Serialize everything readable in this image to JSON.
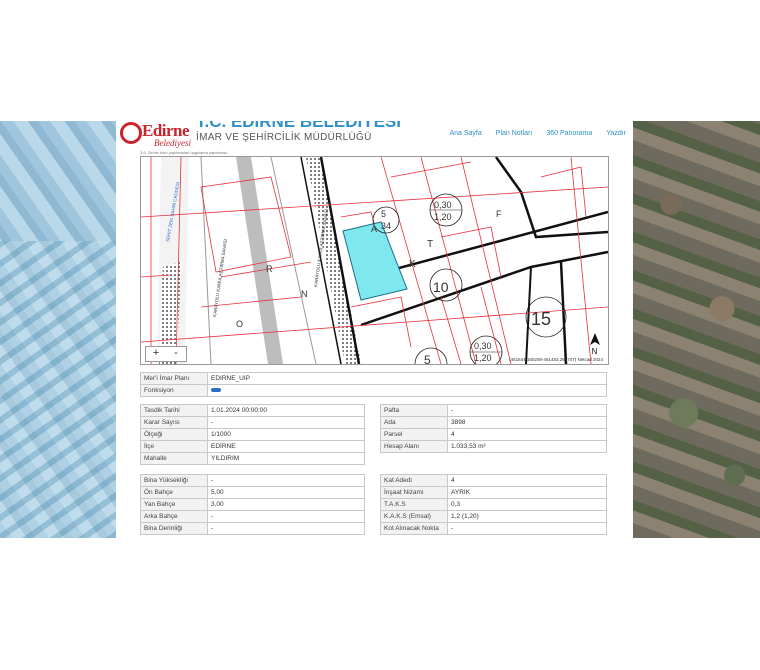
{
  "header": {
    "logo_text": "Edirne",
    "logo_sub": "Belediyesi",
    "org_title": "T.C. EDİRNE BELEDİYESİ",
    "org_subtitle": "İMAR VE ŞEHİRCİLİK MÜDÜRLÜĞÜ",
    "nav": [
      "Ana Sayfa",
      "Plan Notları",
      "360 Panorama",
      "Yazdır"
    ]
  },
  "note": "3.6. Zemin kotu yapılmadan uygulama yapılamaz.",
  "map": {
    "zoom_in": "+",
    "zoom_out": "-",
    "coords": "(461644.160208-461483.260747) Netcad 2024",
    "north": "N",
    "labels": {
      "road1": "SEHIT ZEKI SAHIN CADDESI",
      "road2": "KARAYOLU KAMULAŞTIRMA SAHASI",
      "road3": "KARAYOLU KAMULAŞTIRMA SAHASI",
      "parcel_a": "5",
      "parcel_a2": "34",
      "circle1_top": "0,30",
      "circle1_bot": "1,20",
      "circle2_top": "0,30",
      "circle2_bot": "1,20",
      "floor1": "10",
      "floor2": "15",
      "floor3": "5",
      "letter_k": "K",
      "letter_t": "T",
      "letter_r": "R",
      "letter_n": "N",
      "letter_o": "O",
      "letter_f": "F",
      "letter_a": "A"
    }
  },
  "plan_table": {
    "rows": [
      {
        "label": "Mer'i İmar Planı",
        "value": "EDIRNE_UIP"
      },
      {
        "label": "Fonksiyon",
        "value": ""
      }
    ]
  },
  "left_table": {
    "rows": [
      {
        "label": "Tasdik Tarihi",
        "value": "1.01.2024 00:00:00"
      },
      {
        "label": "Karar Sayısı",
        "value": "-"
      },
      {
        "label": "Ölçeği",
        "value": "1/1000"
      },
      {
        "label": "İlçe",
        "value": "EDİRNE"
      },
      {
        "label": "Mahalle",
        "value": "YILDIRIM"
      }
    ]
  },
  "right_table": {
    "rows": [
      {
        "label": "Pafta",
        "value": "-"
      },
      {
        "label": "Ada",
        "value": "3898"
      },
      {
        "label": "Parsel",
        "value": "4"
      },
      {
        "label": "Hesap Alanı",
        "value": "1.033,53 m²"
      }
    ]
  },
  "build_left": {
    "rows": [
      {
        "label": "Bina Yüksekliği",
        "value": "-"
      },
      {
        "label": "Ön Bahçe",
        "value": "5,00"
      },
      {
        "label": "Yan Bahçe",
        "value": "3,00"
      },
      {
        "label": "Arka Bahçe",
        "value": "-"
      },
      {
        "label": "Bina Derinliği",
        "value": "-"
      }
    ]
  },
  "build_right": {
    "rows": [
      {
        "label": "Kat Adedi",
        "value": "4"
      },
      {
        "label": "İnşaat Nizamı",
        "value": "AYRIK"
      },
      {
        "label": "T.A.K.S",
        "value": "0,3"
      },
      {
        "label": "K.A.K.S (Emsal)",
        "value": "1,2 (1,20)"
      },
      {
        "label": "Kot Alınacak Nokta",
        "value": "-"
      }
    ]
  },
  "colors": {
    "accent": "#2f8fc7",
    "brand": "#c9252c",
    "parcel_fill": "#7fe8ee",
    "plan_line": "#e8303a"
  }
}
